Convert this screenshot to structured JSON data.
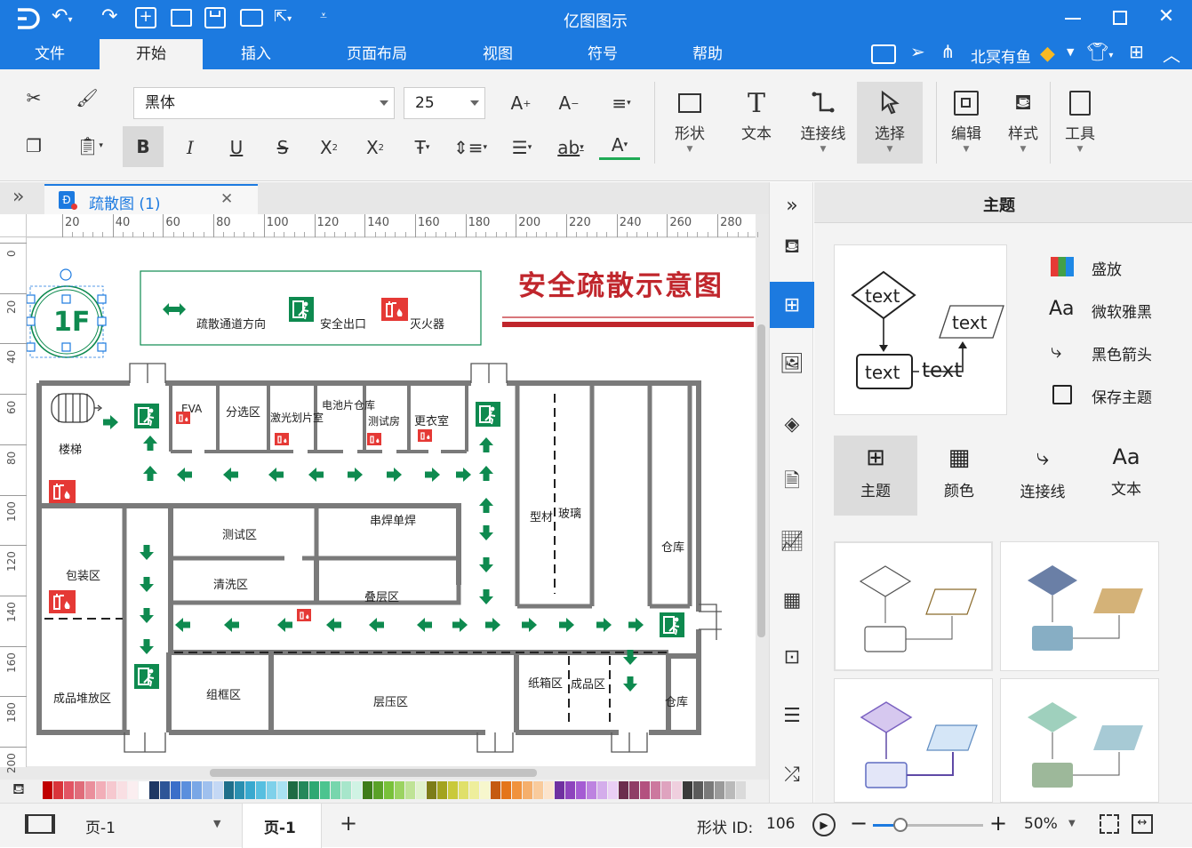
{
  "app": {
    "title": "亿图图示",
    "accent": "#1c7ae0",
    "username": "北冥有鱼"
  },
  "menu": [
    {
      "label": "文件",
      "active": false
    },
    {
      "label": "开始",
      "active": true
    },
    {
      "label": "插入",
      "active": false
    },
    {
      "label": "页面布局",
      "active": false
    },
    {
      "label": "视图",
      "active": false
    },
    {
      "label": "符号",
      "active": false
    },
    {
      "label": "帮助",
      "active": false
    }
  ],
  "ribbon": {
    "font_name": "黑体",
    "font_size": "25",
    "big_buttons": [
      {
        "label": "形状",
        "icon": "rectangle-icon"
      },
      {
        "label": "文本",
        "icon": "text-T-icon"
      },
      {
        "label": "连接线",
        "icon": "connector-icon"
      },
      {
        "label": "选择",
        "icon": "cursor-icon"
      },
      {
        "label": "编辑",
        "icon": "edit-icon"
      },
      {
        "label": "样式",
        "icon": "paint-bucket-icon"
      },
      {
        "label": "工具",
        "icon": "tools-icon"
      }
    ]
  },
  "doc_tab": {
    "label": "疏散图 (1)"
  },
  "ruler": {
    "h_ticks": [
      "20",
      "40",
      "60",
      "80",
      "100",
      "120",
      "140",
      "160",
      "180",
      "200",
      "220",
      "240",
      "260",
      "280"
    ],
    "v_ticks": [
      "0",
      "20",
      "40",
      "60",
      "80",
      "100",
      "120",
      "140",
      "160",
      "180",
      "200"
    ]
  },
  "diagram": {
    "title": "安全疏散示意图",
    "floor_label": "1F",
    "legend": {
      "direction": "疏散通道方向",
      "exit": "安全出口",
      "extinguisher": "灭火器"
    },
    "rooms": {
      "stairs": "楼梯",
      "eva": "EVA",
      "sorting": "分选区",
      "laser": "激光划片室",
      "battery": "电池片仓库",
      "test_room": "测试房",
      "locker": "更衣室",
      "profile_glass_a": "型材",
      "profile_glass_b": "玻璃",
      "warehouse1": "仓库",
      "test_area": "测试区",
      "weld": "串焊单焊",
      "clean": "清洗区",
      "laminate": "叠层区",
      "pack": "包装区",
      "finished_stack": "成品堆放区",
      "frame": "组框区",
      "press": "层压区",
      "carton": "纸箱区",
      "finished": "成品区",
      "warehouse2": "仓库"
    },
    "colors": {
      "green": "#0e8a4f",
      "red": "#e53935",
      "wall": "#7a7a7a"
    }
  },
  "right_panel": {
    "header": "主题",
    "preview_texts": [
      "text",
      "text",
      "text",
      "text"
    ],
    "options": [
      "盛放",
      "微软雅黑",
      "黑色箭头",
      "保存主题"
    ],
    "tabs": [
      {
        "label": "主题",
        "active": true
      },
      {
        "label": "颜色",
        "active": false
      },
      {
        "label": "连接线",
        "active": false
      },
      {
        "label": "文本",
        "active": false
      }
    ]
  },
  "status": {
    "page_dropdown": "页-1",
    "page_tab": "页-1",
    "shape_id_label": "形状 ID:",
    "shape_id": "106",
    "zoom": "50%",
    "zoom_fraction": 0.25
  },
  "palette_colors": [
    "#c00000",
    "#d9343a",
    "#e25564",
    "#e06c7a",
    "#ea8f9c",
    "#f2aeb8",
    "#f6c8cf",
    "#f9dfe3",
    "#fbeef0",
    "#ffffff",
    "#1f3864",
    "#2e5597",
    "#3b6fc9",
    "#5b8fdd",
    "#7aa7e6",
    "#9fc0ee",
    "#c4d8f5",
    "#1f6f8b",
    "#2a8fb0",
    "#39a9cf",
    "#57bfe0",
    "#7fd1ea",
    "#a9e2f2",
    "#1e6b43",
    "#24885a",
    "#2fa872",
    "#4cc48f",
    "#77d6ad",
    "#a7e6cb",
    "#d0f3e4",
    "#3d7d19",
    "#5aa127",
    "#79c13a",
    "#9bd361",
    "#bfe396",
    "#e0f2cc",
    "#7d7d18",
    "#a3a31f",
    "#c9c93a",
    "#e0e06a",
    "#eeee9c",
    "#f7f7cd",
    "#c55a11",
    "#e4751b",
    "#f0923d",
    "#f5af6c",
    "#f9cb9c",
    "#fce4cc",
    "#7030a0",
    "#8e44bd",
    "#a55cd3",
    "#bd83e0",
    "#d4adeb",
    "#eacff5",
    "#6b2d4d",
    "#8f3d66",
    "#b3517f",
    "#cc789e",
    "#dfa3bf",
    "#efcfde",
    "#3a3a3a",
    "#5a5a5a",
    "#7a7a7a",
    "#9a9a9a",
    "#bababa",
    "#dadada"
  ]
}
